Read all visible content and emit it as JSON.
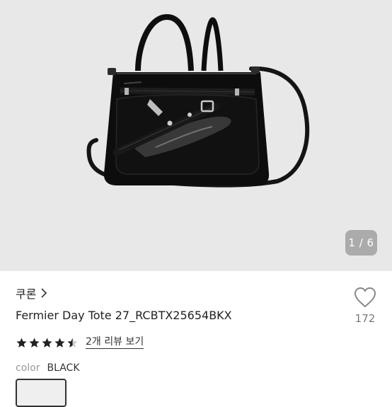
{
  "gallery": {
    "image_alt": "Fermier Day Tote bag product photo",
    "current_page": "1",
    "total_pages": "6",
    "counter_text": "1 / 6"
  },
  "product": {
    "brand": "쿠론",
    "name": "Fermier Day Tote 27_RCBTX25654BKX",
    "rating": 4.5,
    "reviews_link": "2개 리뷰 보기",
    "wish_count": "172",
    "color_label": "color",
    "color_value": "BLACK"
  },
  "icons": {
    "brand_chevron": "chevron-right-icon",
    "wish": "heart-outline-icon",
    "star": "star-icon"
  },
  "colors": {
    "gallery_bg": "#e8e8e8",
    "text": "#222222",
    "muted": "#999999",
    "star": "#222222"
  }
}
